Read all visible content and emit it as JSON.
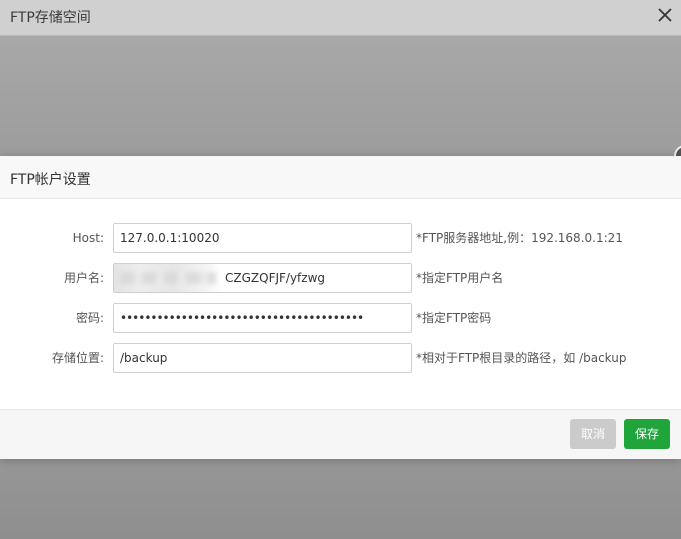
{
  "background_window": {
    "title": "FTP存储空间"
  },
  "dialog": {
    "title": "FTP帐户设置",
    "fields": [
      {
        "label": "Host:",
        "value": "127.0.0.1:10020",
        "hint": "*FTP服务器地址,例：192.168.0.1:21"
      },
      {
        "label": "用户名:",
        "value": "CZGZQFJF/yfzwg",
        "hint": "*指定FTP用户名",
        "redacted": true
      },
      {
        "label": "密码:",
        "value": "••••••••••••••••••••••••••••••••••••••••",
        "hint": "*指定FTP密码"
      },
      {
        "label": "存储位置:",
        "value": "/backup",
        "hint": "*相对于FTP根目录的路径，如 /backup"
      }
    ],
    "buttons": {
      "cancel": "取消",
      "save": "保存"
    }
  },
  "colors": {
    "accent_green": "#20a53a",
    "disabled_button": "#cbcbcb",
    "overlay": "#9c9c9c"
  },
  "icons": {
    "close": "close-icon"
  }
}
